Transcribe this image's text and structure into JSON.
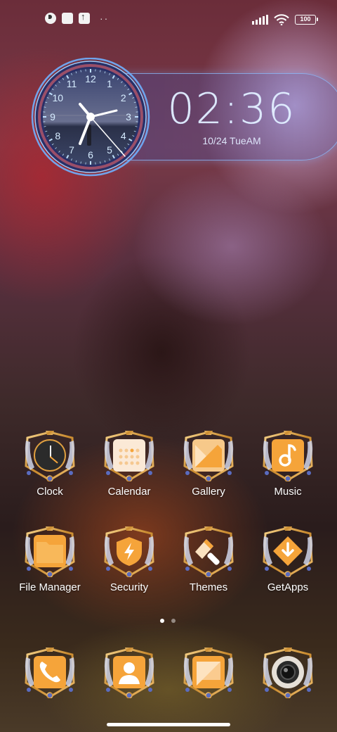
{
  "status_bar": {
    "battery": "100",
    "icons": [
      "notification-app-icon",
      "notification-square-icon",
      "upload-icon",
      "more-dots-icon",
      "signal-icon",
      "wifi-icon",
      "battery-icon"
    ],
    "more": "··"
  },
  "clock_widget": {
    "time": "02:36",
    "date": "10/24 TueAM",
    "dial_numbers": [
      "12",
      "1",
      "2",
      "3",
      "4",
      "5",
      "6",
      "7",
      "8",
      "9",
      "10",
      "11"
    ]
  },
  "apps": {
    "row1": [
      {
        "label": "Clock",
        "icon": "clock-icon"
      },
      {
        "label": "Calendar",
        "icon": "calendar-icon"
      },
      {
        "label": "Gallery",
        "icon": "gallery-icon"
      },
      {
        "label": "Music",
        "icon": "music-icon"
      }
    ],
    "row2": [
      {
        "label": "File Manager",
        "icon": "folder-icon"
      },
      {
        "label": "Security",
        "icon": "security-shield-icon"
      },
      {
        "label": "Themes",
        "icon": "themes-brush-icon"
      },
      {
        "label": "GetApps",
        "icon": "getapps-download-icon"
      }
    ]
  },
  "dock": [
    {
      "icon": "phone-icon"
    },
    {
      "icon": "contacts-icon"
    },
    {
      "icon": "messages-icon"
    },
    {
      "icon": "camera-icon"
    }
  ],
  "pager": {
    "pages": 2,
    "current": 1
  },
  "colors": {
    "icon_orange": "#f5a43a",
    "frame_gold": "#d9a24a",
    "widget_accent": "#8cbeff"
  }
}
